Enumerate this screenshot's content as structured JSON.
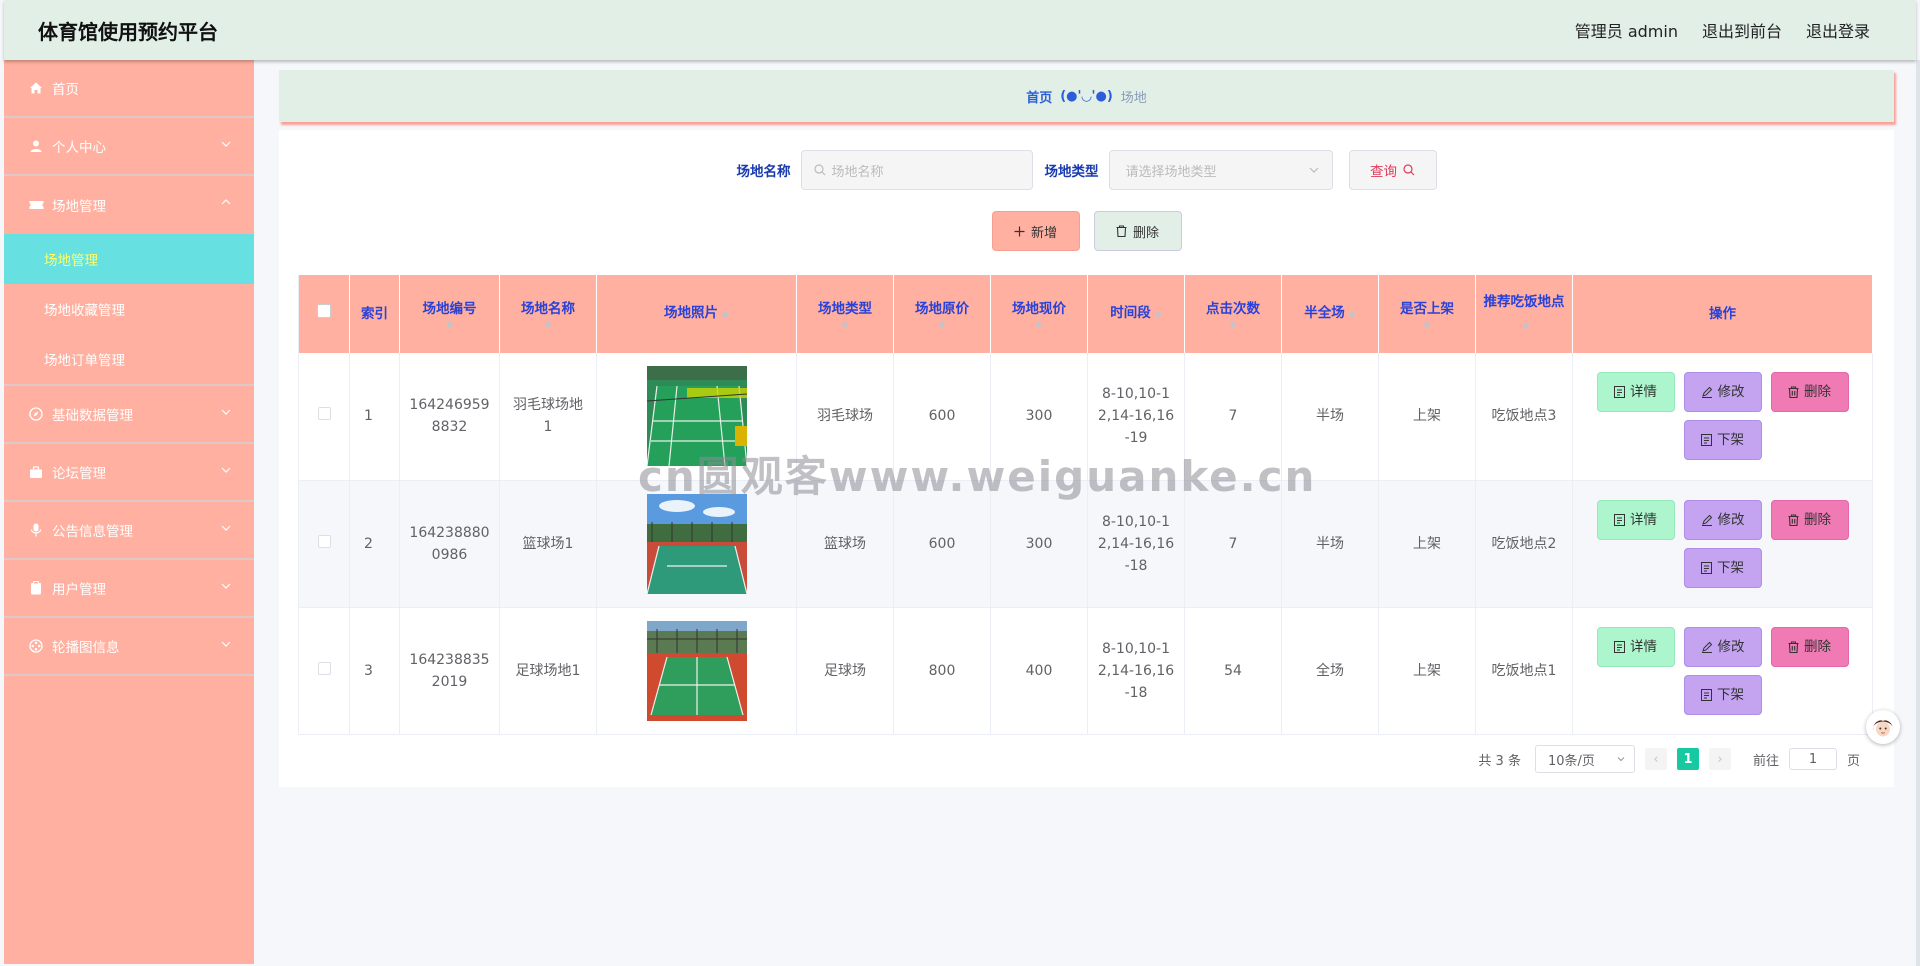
{
  "header": {
    "title": "体育馆使用预约平台",
    "admin": "管理员 admin",
    "to_front": "退出到前台",
    "logout": "退出登录"
  },
  "sidebar": {
    "home": "首页",
    "personal": "个人中心",
    "venue_mgmt": "场地管理",
    "sub_items": [
      "场地管理",
      "场地收藏管理",
      "场地订单管理"
    ],
    "basic_data": "基础数据管理",
    "forum": "论坛管理",
    "notice": "公告信息管理",
    "users": "用户管理",
    "carousel": "轮播图信息"
  },
  "breadcrumb": {
    "home": "首页",
    "face": "(●'◡'●)",
    "current": "场地"
  },
  "search": {
    "name_label": "场地名称",
    "name_placeholder": "场地名称",
    "type_label": "场地类型",
    "type_placeholder": "请选择场地类型",
    "query_label": "查询"
  },
  "actions": {
    "add": "新增",
    "delete": "删除"
  },
  "table": {
    "columns": [
      "索引",
      "场地编号",
      "场地名称",
      "场地照片",
      "场地类型",
      "场地原价",
      "场地现价",
      "时间段",
      "点击次数",
      "半全场",
      "是否上架",
      "推荐吃饭地点",
      "操作"
    ],
    "rows": [
      {
        "index": "1",
        "code_a": "164246959",
        "code_b": "8832",
        "name_a": "羽毛球场地",
        "name_b": "1",
        "photo": "badminton",
        "type": "羽毛球场",
        "orig": "600",
        "now": "300",
        "time_a": "8-10,10-1",
        "time_b": "2,14-16,16",
        "time_c": "-19",
        "clicks": "7",
        "half": "半场",
        "listed": "上架",
        "food": "吃饭地点3"
      },
      {
        "index": "2",
        "code_a": "164238880",
        "code_b": "0986",
        "name_a": "篮球场1",
        "name_b": "",
        "photo": "basketball",
        "type": "篮球场",
        "orig": "600",
        "now": "300",
        "time_a": "8-10,10-1",
        "time_b": "2,14-16,16",
        "time_c": "-18",
        "clicks": "7",
        "half": "半场",
        "listed": "上架",
        "food": "吃饭地点2"
      },
      {
        "index": "3",
        "code_a": "164238835",
        "code_b": "2019",
        "name_a": "足球场地1",
        "name_b": "",
        "photo": "football",
        "type": "足球场",
        "orig": "800",
        "now": "400",
        "time_a": "8-10,10-1",
        "time_b": "2,14-16,16",
        "time_c": "-18",
        "clicks": "54",
        "half": "全场",
        "listed": "上架",
        "food": "吃饭地点1"
      }
    ],
    "op_labels": {
      "detail": "详情",
      "edit": "修改",
      "remove": "删除",
      "off": "下架"
    }
  },
  "pagination": {
    "total": "共 3 条",
    "page_size": "10条/页",
    "current": "1",
    "goto_label": "前往",
    "goto_value": "1",
    "page_unit": "页"
  },
  "watermark": "cn圆观客www.weiguanke.cn",
  "colors": {
    "topbar": "#e1efe7",
    "sidebar": "#ffb0a0",
    "sidebar_active": "#66e0e0",
    "header_text": "#2a42d8",
    "pager_active": "#16c9a0"
  }
}
